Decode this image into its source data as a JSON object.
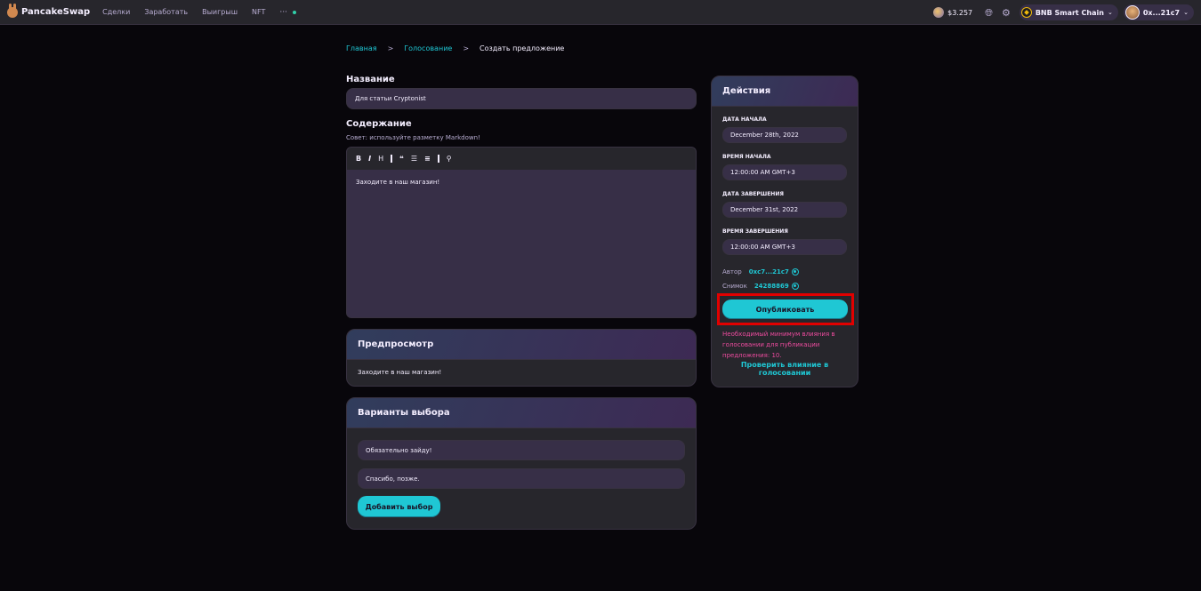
{
  "header": {
    "logo_text": "PancakeSwap",
    "nav": [
      "Сделки",
      "Заработать",
      "Выигрыш",
      "NFT"
    ],
    "more": "···",
    "price": "$3.257",
    "chain": "BNB Smart Chain",
    "wallet": "0x...21c7"
  },
  "breadcrumb": {
    "home": "Главная",
    "voting": "Голосование",
    "current": "Создать предложение",
    "sep": ">"
  },
  "form": {
    "title_label": "Название",
    "title_value": "Для статьи Cryptonist",
    "content_label": "Содержание",
    "content_hint": "Совет: используйте разметку Markdown!",
    "toolbar": {
      "bold": "B",
      "italic": "I",
      "heading": "H",
      "quote": "❝",
      "ul": "☰",
      "ol": "≡",
      "link": "⚲"
    },
    "content_value": "Заходите в наш магазин!"
  },
  "preview": {
    "title": "Предпросмотр",
    "text": "Заходите в наш магазин!"
  },
  "choices": {
    "title": "Варианты выбора",
    "items": [
      "Обязательно зайду!",
      "Спасибо, позже."
    ],
    "add_button": "Добавить выбор"
  },
  "actions": {
    "title": "Действия",
    "start_date_label": "ДАТА НАЧАЛА",
    "start_date": "December 28th, 2022",
    "start_time_label": "ВРЕМЯ НАЧАЛА",
    "start_time": "12:00:00 AM GMT+3",
    "end_date_label": "ДАТА ЗАВЕРШЕНИЯ",
    "end_date": "December 31st, 2022",
    "end_time_label": "ВРЕМЯ ЗАВЕРШЕНИЯ",
    "end_time": "12:00:00 AM GMT+3",
    "author_label": "Автор",
    "author_value": "0xc7...21c7",
    "snapshot_label": "Снимок",
    "snapshot_value": "24288869",
    "publish_button": "Опубликовать",
    "warning": "Необходимый минимум влияния в голосовании для публикации предложения: 10.",
    "check_link": "Проверить влияние в голосовании"
  },
  "colors": {
    "accent": "#1fc7d4",
    "background": "#08060b",
    "card": "#27262c",
    "input": "#372f47",
    "warning": "#ed4b9e",
    "highlight": "#e10000"
  }
}
